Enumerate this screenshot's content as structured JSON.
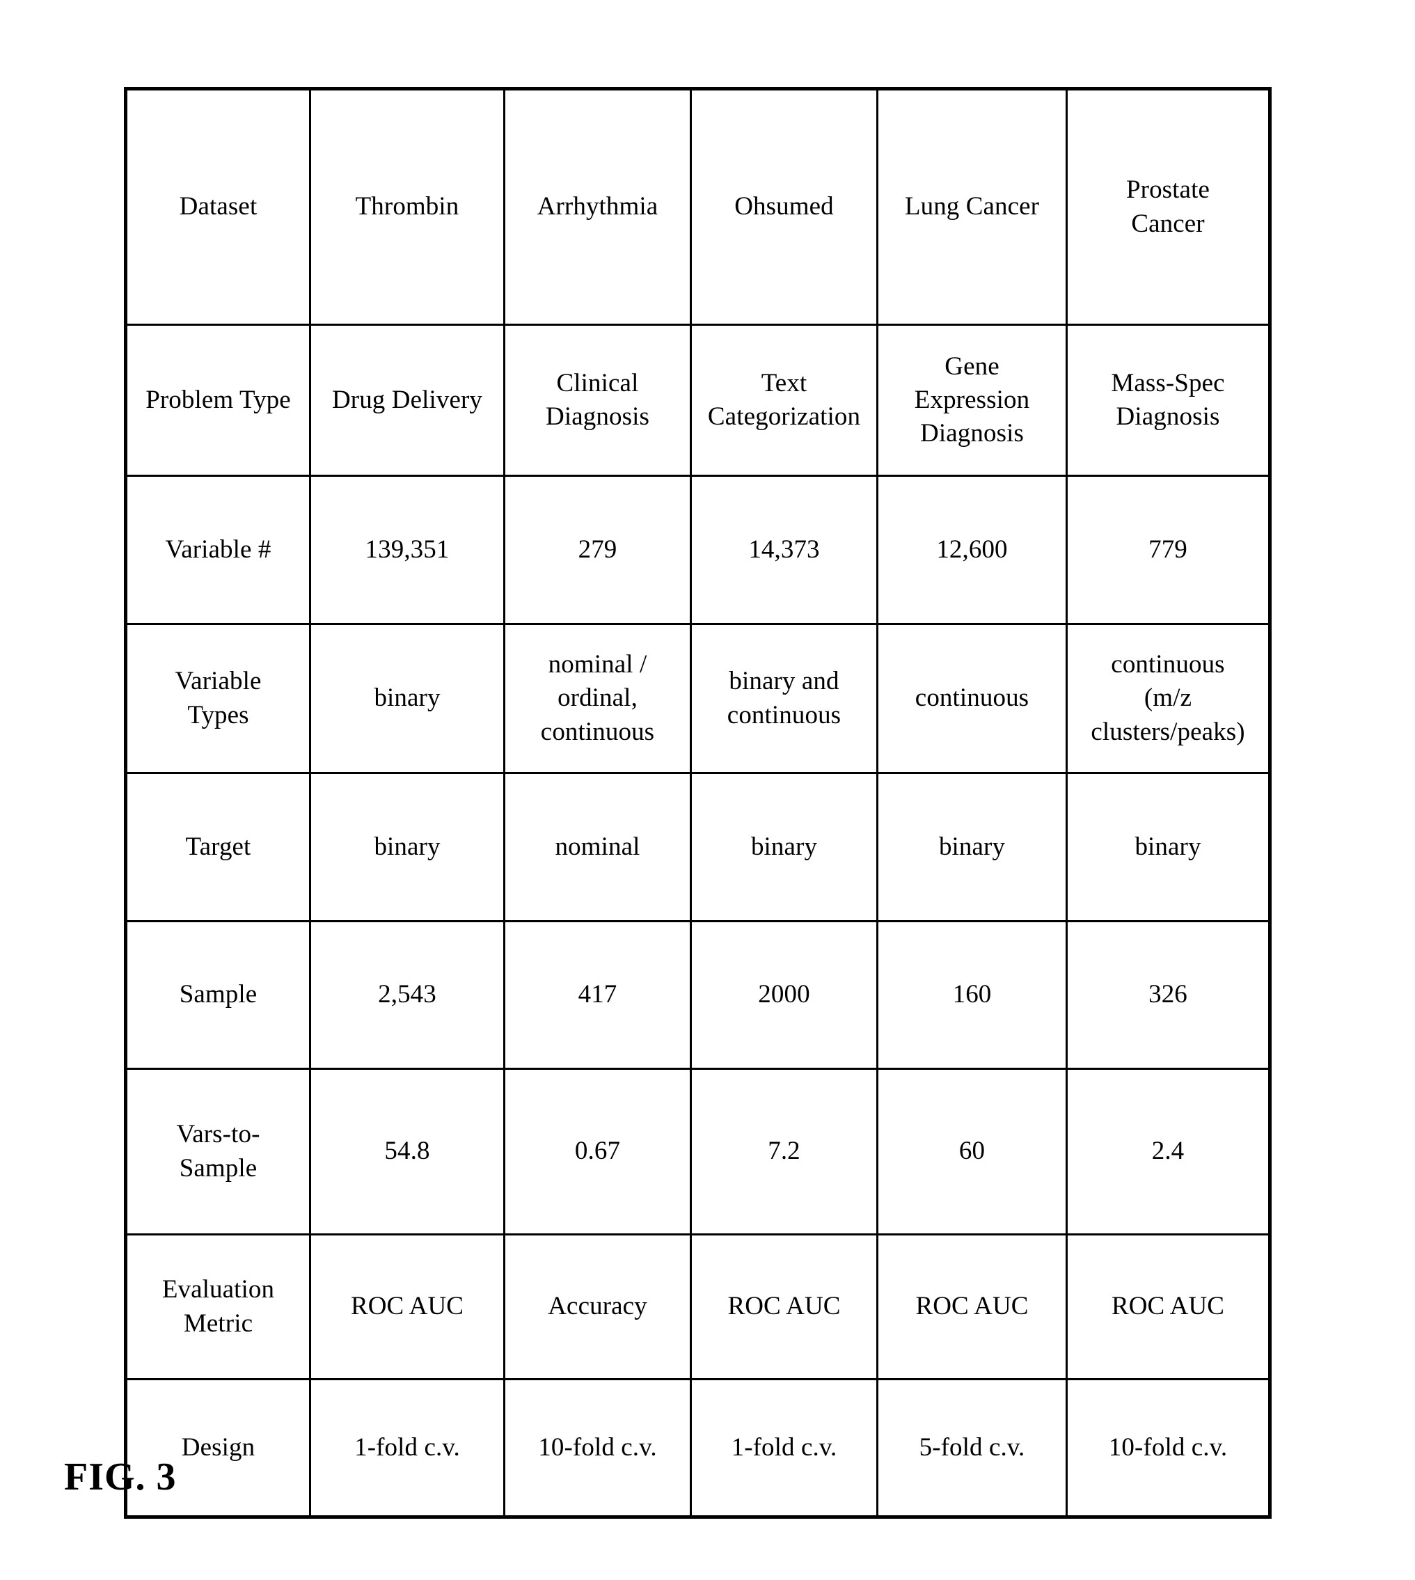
{
  "figure": {
    "caption": "FIG. 3"
  },
  "table": {
    "row_labels": [
      "Dataset",
      "Problem Type",
      "Variable #",
      "Variable\nTypes",
      "Target",
      "Sample",
      "Vars-to-\nSample",
      "Evaluation\nMetric",
      "Design"
    ],
    "columns": [
      "Thrombin",
      "Arrhythmia",
      "Ohsumed",
      "Lung Cancer",
      "Prostate\nCancer"
    ],
    "rows": [
      {
        "label": "Problem Type",
        "values": [
          "Drug Delivery",
          "Clinical\nDiagnosis",
          "Text\nCategorization",
          "Gene\nExpression\nDiagnosis",
          "Mass-Spec\nDiagnosis"
        ]
      },
      {
        "label": "Variable #",
        "values": [
          "139,351",
          "279",
          "14,373",
          "12,600",
          "779"
        ]
      },
      {
        "label": "Variable\nTypes",
        "values": [
          "binary",
          "nominal /\nordinal,\ncontinuous",
          "binary and\ncontinuous",
          "continuous",
          "continuous\n(m/z\nclusters/peaks)"
        ]
      },
      {
        "label": "Target",
        "values": [
          "binary",
          "nominal",
          "binary",
          "binary",
          "binary"
        ]
      },
      {
        "label": "Sample",
        "values": [
          "2,543",
          "417",
          "2000",
          "160",
          "326"
        ]
      },
      {
        "label": "Vars-to-\nSample",
        "values": [
          "54.8",
          "0.67",
          "7.2",
          "60",
          "2.4"
        ]
      },
      {
        "label": "Evaluation\nMetric",
        "values": [
          "ROC AUC",
          "Accuracy",
          "ROC AUC",
          "ROC AUC",
          "ROC AUC"
        ]
      },
      {
        "label": "Design",
        "values": [
          "1-fold c.v.",
          "10-fold c.v.",
          "1-fold c.v.",
          "5-fold c.v.",
          "10-fold c.v."
        ]
      }
    ]
  }
}
